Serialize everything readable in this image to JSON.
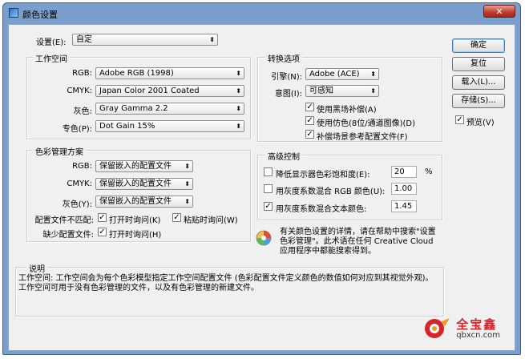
{
  "window": {
    "title": "颜色设置",
    "close_label": "✕"
  },
  "settings": {
    "label": "设置(E):",
    "value": "自定"
  },
  "working_spaces": {
    "title": "工作空间",
    "rgb": {
      "label": "RGB:",
      "value": "Adobe RGB (1998)"
    },
    "cmyk": {
      "label": "CMYK:",
      "value": "Japan Color 2001 Coated"
    },
    "gray": {
      "label": "灰色:",
      "value": "Gray Gamma 2.2"
    },
    "spot": {
      "label": "专色(P):",
      "value": "Dot Gain 15%"
    }
  },
  "color_management": {
    "title": "色彩管理方案",
    "rgb": {
      "label": "RGB:",
      "value": "保留嵌入的配置文件"
    },
    "cmyk": {
      "label": "CMYK:",
      "value": "保留嵌入的配置文件"
    },
    "gray": {
      "label": "灰色(Y):",
      "value": "保留嵌入的配置文件"
    },
    "mismatch": {
      "label": "配置文件不匹配:",
      "ask_open": "打开时询问(K)",
      "ask_paste": "粘贴时询问(W)"
    },
    "missing": {
      "label": "缺少配置文件:",
      "ask_open": "打开时询问(H)"
    }
  },
  "conversion": {
    "title": "转换选项",
    "engine": {
      "label": "引擎(N):",
      "value": "Adobe (ACE)"
    },
    "intent": {
      "label": "意图(I):",
      "value": "可感知"
    },
    "bpc": "使用黑场补偿(A)",
    "dither": "使用仿色(8位/通道图像)(D)",
    "scene": "补偿场景参考配置文件(F)"
  },
  "advanced": {
    "title": "高级控制",
    "desaturate": {
      "label": "降低显示器色彩饱和度(E):",
      "value": "20",
      "unit": "%"
    },
    "blend_rgb": {
      "label": "用灰度系数混合 RGB 颜色(U):",
      "value": "1.00"
    },
    "blend_text": {
      "label": "用灰度系数混合文本颜色:",
      "value": "1.45"
    }
  },
  "info_text": "有关颜色设置的详情，请在帮助中搜索\"设置色彩管理\"。此术语在任何 Creative Cloud 应用程序中都能搜索得到。",
  "buttons": {
    "ok": "确定",
    "reset": "复位",
    "load": "载入(L)...",
    "save": "存储(S)...",
    "preview": "预览(V)"
  },
  "description": {
    "title": "说明",
    "text": "工作空间: 工作空间会为每个色彩模型指定工作空间配置文件 (色彩配置文件定义颜色的数值如何对应到其视觉外观)。工作空间可用于没有色彩管理的文件，以及有色彩管理的新建文件。"
  },
  "watermark": {
    "name": "全宝鑫",
    "url": "qbxcn.com"
  },
  "checkmark": "✓",
  "arrow": "⬍",
  "colors": {
    "title_bar": "#7a9fcd",
    "close_red": "#c0392b",
    "dialog_bg": "#f0f0f0",
    "watermark_red": "#d9232a"
  }
}
